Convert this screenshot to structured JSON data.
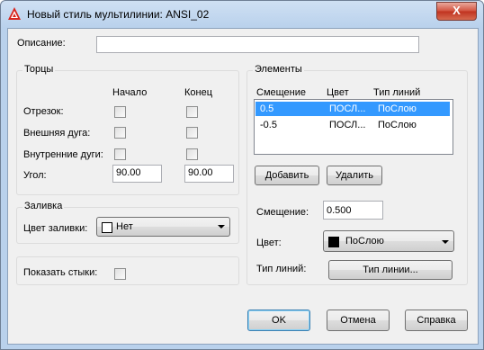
{
  "window": {
    "title": "Новый стиль мультилинии: ANSI_02",
    "close_glyph": "X"
  },
  "description": {
    "label": "Описание:",
    "value": ""
  },
  "caps": {
    "legend": "Торцы",
    "col_start": "Начало",
    "col_end": "Конец",
    "rows": [
      {
        "label": "Отрезок:"
      },
      {
        "label": "Внешняя дуга:"
      },
      {
        "label": "Внутренние дуги:"
      }
    ],
    "angle_label": "Угол:",
    "angle_start": "90.00",
    "angle_end": "90.00"
  },
  "fill": {
    "legend": "Заливка",
    "label": "Цвет заливки:",
    "value": "Нет",
    "swatch_color": "#ffffff"
  },
  "joints": {
    "label": "Показать стыки:"
  },
  "elements": {
    "legend": "Элементы",
    "headers": {
      "offset": "Смещение",
      "color": "Цвет",
      "linetype": "Тип линий"
    },
    "rows": [
      {
        "offset": "0.5",
        "color": "ПОСЛ...",
        "linetype": "ПоСлою",
        "selected": true
      },
      {
        "offset": "-0.5",
        "color": "ПОСЛ...",
        "linetype": "ПоСлою",
        "selected": false
      }
    ],
    "add_button": "Добавить",
    "delete_button": "Удалить",
    "offset_label": "Смещение:",
    "offset_value": "0.500",
    "color_label": "Цвет:",
    "color_value": "ПоСлою",
    "color_swatch": "#000000",
    "linetype_label": "Тип линий:",
    "linetype_button": "Тип линии..."
  },
  "footer": {
    "ok": "OK",
    "cancel": "Отмена",
    "help": "Справка"
  },
  "colors": {
    "selection": "#3399ff",
    "title_bar": "#b9d1ec",
    "close_button": "#c0321f"
  }
}
